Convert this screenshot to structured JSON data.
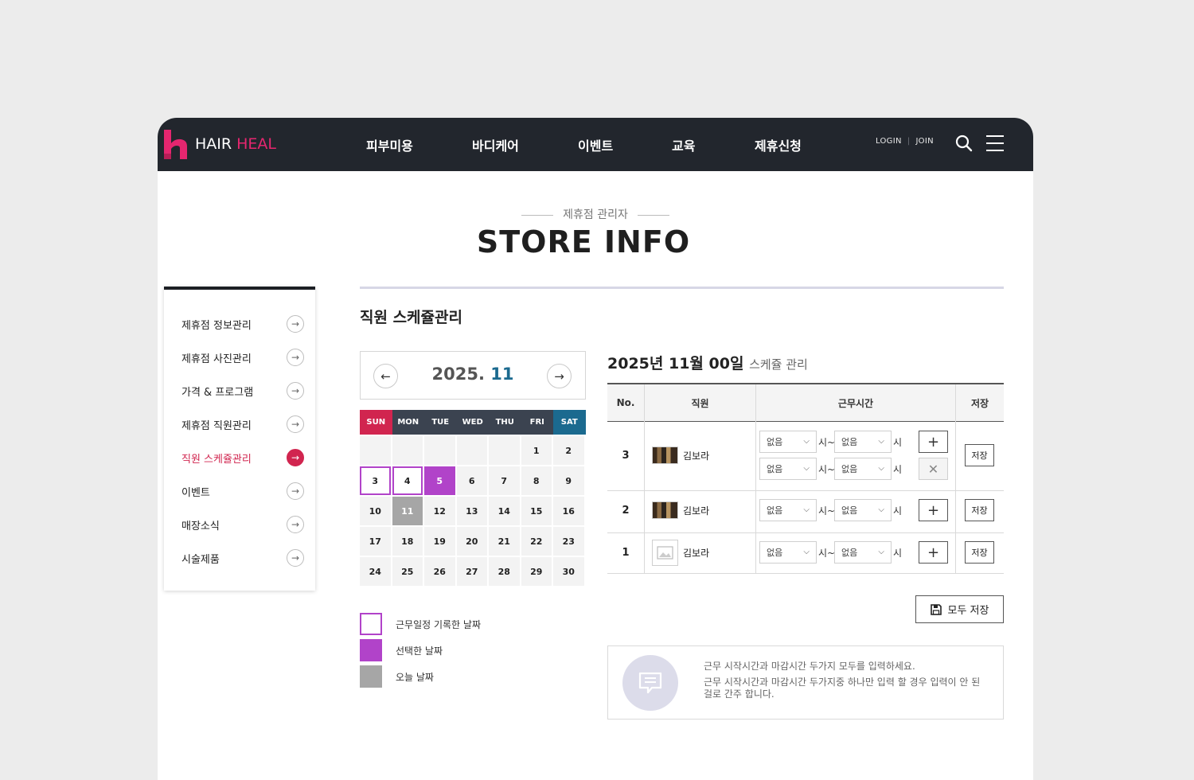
{
  "brand": {
    "word1": "HAIR",
    "word2": "HEAL",
    "accent": "#e5266f"
  },
  "nav": {
    "items": [
      "피부미용",
      "바디케어",
      "이벤트",
      "교육",
      "제휴신청"
    ]
  },
  "toplinks": {
    "login": "LOGIN",
    "sep": "|",
    "join": "JOIN"
  },
  "icons": {
    "search": "search-icon",
    "menu": "hamburger-menu-icon"
  },
  "page": {
    "subtitle": "제휴점 관리자",
    "title": "STORE INFO"
  },
  "sidebar": {
    "items": [
      {
        "label": "제휴점 정보관리",
        "active": false
      },
      {
        "label": "제휴점 사진관리",
        "active": false
      },
      {
        "label": "가격 & 프로그램",
        "active": false
      },
      {
        "label": "제휴점 직원관리",
        "active": false
      },
      {
        "label": "직원 스케쥴관리",
        "active": true
      },
      {
        "label": "이벤트",
        "active": false
      },
      {
        "label": "매장소식",
        "active": false
      },
      {
        "label": "시술제품",
        "active": false
      }
    ]
  },
  "section": {
    "title": "직원 스케쥴관리"
  },
  "calendar": {
    "year": "2025.",
    "month": "11",
    "weekdays": [
      "SUN",
      "MON",
      "TUE",
      "WED",
      "THU",
      "FRI",
      "SAT"
    ],
    "weeks": [
      [
        "",
        "",
        "",
        "",
        "",
        "1",
        "2"
      ],
      [
        "3",
        "4",
        "5",
        "6",
        "7",
        "8",
        "9"
      ],
      [
        "10",
        "11",
        "12",
        "13",
        "14",
        "15",
        "16"
      ],
      [
        "17",
        "18",
        "19",
        "20",
        "21",
        "22",
        "23"
      ],
      [
        "24",
        "25",
        "26",
        "27",
        "28",
        "29",
        "30"
      ]
    ],
    "recorded_days": [
      "3",
      "4"
    ],
    "selected_day": "5",
    "today": "11",
    "colors": {
      "sun": "#d1254f",
      "sat": "#1b6a8f",
      "recorded": "#b143c9",
      "selected": "#b143c9",
      "today": "#a6a6a6"
    }
  },
  "legend": {
    "recorded": "근무일정 기록한 날짜",
    "selected": "선택한 날짜",
    "today": "오늘 날짜"
  },
  "schedule": {
    "title": "2025년 11월 00일",
    "title_suffix": "스케쥴 관리",
    "headers": {
      "no": "No.",
      "staff": "직원",
      "hours": "근무시간",
      "save": "저장"
    },
    "select_default": "없음",
    "unit_from": "시~",
    "unit_to": "시",
    "save_label": "저장",
    "rows": [
      {
        "no": "3",
        "name": "김보라",
        "photo": true,
        "slots": 2
      },
      {
        "no": "2",
        "name": "김보라",
        "photo": true,
        "slots": 1
      },
      {
        "no": "1",
        "name": "김보라",
        "photo": false,
        "slots": 1
      }
    ]
  },
  "save_all": {
    "label": "모두 저장"
  },
  "notice": {
    "line1": "근무 시작시간과 마감시간 두가지 모두를 입력하세요.",
    "line2": "근무 시작시간과 마감시간 두가지중 하나만 입력 할 경우 입력이 안 된 걸로 간주 합니다."
  }
}
